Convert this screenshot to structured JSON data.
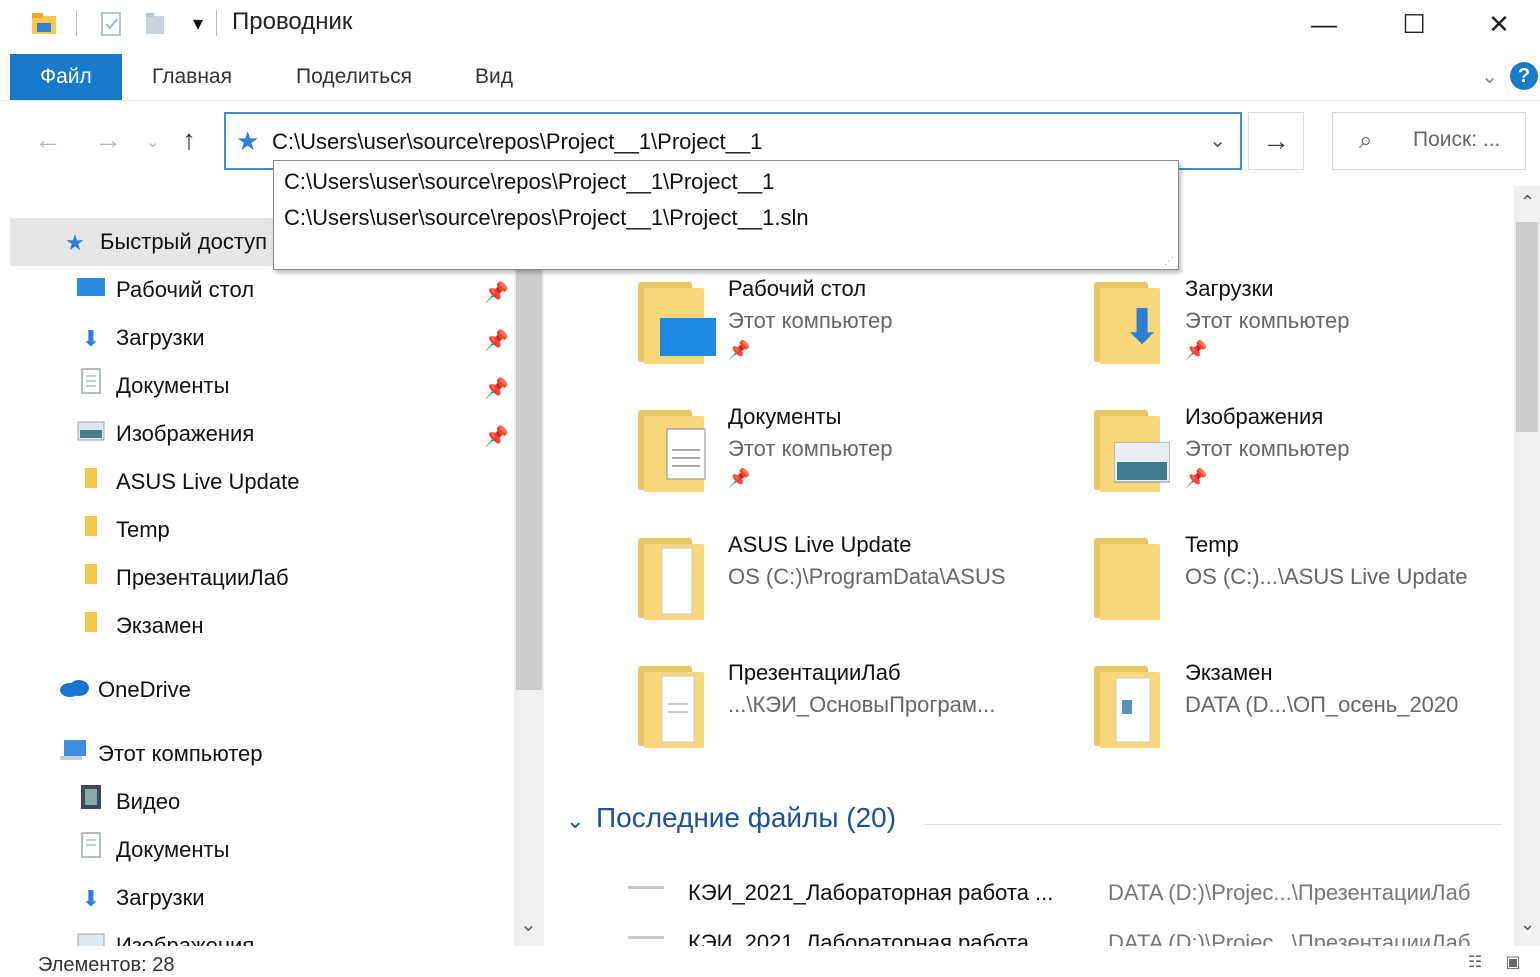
{
  "window": {
    "title": "Проводник",
    "minimize": "—",
    "maximize": "☐",
    "close": "✕"
  },
  "ribbon": {
    "tabs": [
      "Файл",
      "Главная",
      "Поделиться",
      "Вид"
    ],
    "help": "?"
  },
  "nav": {
    "address_path": "C:\\Users\\user\\source\\repos\\Project__1\\Project__1",
    "search_placeholder": "Поиск: ..."
  },
  "autocomplete": {
    "items": [
      "C:\\Users\\user\\source\\repos\\Project__1\\Project__1",
      "C:\\Users\\user\\source\\repos\\Project__1\\Project__1.sln"
    ]
  },
  "sidebar": {
    "quick_access": "Быстрый доступ",
    "pinned": [
      "Рабочий стол",
      "Загрузки",
      "Документы",
      "Изображения"
    ],
    "folders": [
      "ASUS Live Update",
      "Temp",
      "ПрезентацииЛаб",
      "Экзамен"
    ],
    "onedrive": "OneDrive",
    "this_pc": "Этот компьютер",
    "pc_items": [
      "Видео",
      "Документы",
      "Загрузки",
      "Изображения"
    ]
  },
  "main": {
    "tiles": [
      {
        "name": "Рабочий стол",
        "sub": "Этот компьютер",
        "pinned": true
      },
      {
        "name": "Загрузки",
        "sub": "Этот компьютер",
        "pinned": true
      },
      {
        "name": "Документы",
        "sub": "Этот компьютер",
        "pinned": true
      },
      {
        "name": "Изображения",
        "sub": "Этот компьютер",
        "pinned": true
      },
      {
        "name": "ASUS Live Update",
        "sub": "OS (C:)\\ProgramData\\ASUS",
        "pinned": false
      },
      {
        "name": "Temp",
        "sub": "OS (C:)...\\ASUS Live Update",
        "pinned": false
      },
      {
        "name": "ПрезентацииЛаб",
        "sub": "...\\КЭИ_ОсновыПрограм...",
        "pinned": false
      },
      {
        "name": "Экзамен",
        "sub": "DATA (D...\\ОП_осень_2020",
        "pinned": false
      }
    ],
    "recent_header": "Последние файлы (20)",
    "recent": [
      {
        "name": "КЭИ_2021_Лабораторная работа ...",
        "path": "DATA (D:)\\Projec...\\ПрезентацииЛаб"
      },
      {
        "name": "КЭИ_2021_Лабораторная работа ...",
        "path": "DATA (D:)\\Projec...\\ПрезентацииЛаб"
      }
    ]
  },
  "status": {
    "count": "Элементов: 28"
  }
}
